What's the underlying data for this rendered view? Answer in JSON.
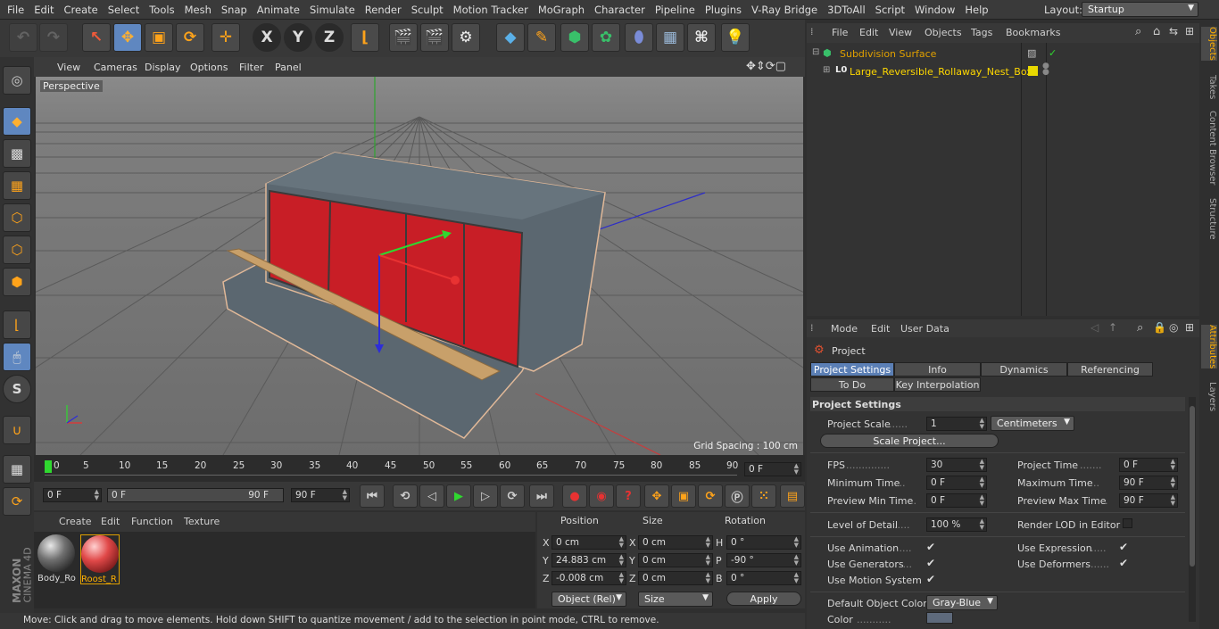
{
  "menubar": {
    "items": [
      "File",
      "Edit",
      "Create",
      "Select",
      "Tools",
      "Mesh",
      "Snap",
      "Animate",
      "Simulate",
      "Render",
      "Sculpt",
      "Motion Tracker",
      "MoGraph",
      "Character",
      "Pipeline",
      "Plugins",
      "V-Ray Bridge",
      "3DToAll",
      "Script",
      "Window",
      "Help"
    ],
    "layout_label": "Layout:",
    "layout_value": "Startup"
  },
  "toolbar": {
    "axis_x": "X",
    "axis_y": "Y",
    "axis_z": "Z"
  },
  "left_tools": {
    "snap_label": "S"
  },
  "viewport": {
    "menu": [
      "View",
      "Cameras",
      "Display",
      "Options",
      "Filter",
      "Panel"
    ],
    "label": "Perspective",
    "grid_spacing": "Grid Spacing : 100 cm"
  },
  "timeline": {
    "ticks": [
      "0",
      "5",
      "10",
      "15",
      "20",
      "25",
      "30",
      "35",
      "40",
      "45",
      "50",
      "55",
      "60",
      "65",
      "70",
      "75",
      "80",
      "85",
      "90"
    ],
    "current_frame": "0 F"
  },
  "transport": {
    "start": "0 F",
    "range_start": "0 F",
    "range_end": "90 F",
    "end": "90 F"
  },
  "materials": {
    "menu": [
      "Create",
      "Edit",
      "Function",
      "Texture"
    ],
    "items": [
      {
        "name": "Body_Ro"
      },
      {
        "name": "Roost_R"
      }
    ]
  },
  "coords": {
    "headers": [
      "Position",
      "Size",
      "Rotation"
    ],
    "rows": [
      {
        "axis": "X",
        "pos": "0 cm",
        "saxis": "X",
        "size": "0 cm",
        "raxis": "H",
        "rot": "0 °"
      },
      {
        "axis": "Y",
        "pos": "24.883 cm",
        "saxis": "Y",
        "size": "0 cm",
        "raxis": "P",
        "rot": "-90 °"
      },
      {
        "axis": "Z",
        "pos": "-0.008 cm",
        "saxis": "Z",
        "size": "0 cm",
        "raxis": "B",
        "rot": "0 °"
      }
    ],
    "mode": "Object (Rel)",
    "size_mode": "Size",
    "apply": "Apply"
  },
  "status": "Move: Click and drag to move elements. Hold down SHIFT to quantize movement / add to the selection in point mode, CTRL to remove.",
  "objects": {
    "menu": [
      "File",
      "Edit",
      "View",
      "Objects",
      "Tags",
      "Bookmarks"
    ],
    "tree": [
      {
        "name": "Subdivision Surface"
      },
      {
        "name": "Large_Reversible_Rollaway_Nest_Box"
      }
    ]
  },
  "attributes": {
    "menu": [
      "Mode",
      "Edit",
      "User Data"
    ],
    "title": "Project",
    "tabs": [
      "Project Settings",
      "Info",
      "Dynamics",
      "Referencing",
      "To Do",
      "Key Interpolation"
    ],
    "section": "Project Settings",
    "project_scale_label": "Project Scale",
    "project_scale_value": "1",
    "project_scale_unit": "Centimeters",
    "scale_button": "Scale Project...",
    "fps_label": "FPS",
    "fps_value": "30",
    "project_time_label": "Project Time",
    "project_time_value": "0 F",
    "min_time_label": "Minimum Time",
    "min_time_value": "0 F",
    "max_time_label": "Maximum Time",
    "max_time_value": "90 F",
    "prev_min_label": "Preview Min Time",
    "prev_min_value": "0 F",
    "prev_max_label": "Preview Max Time",
    "prev_max_value": "90 F",
    "lod_label": "Level of Detail",
    "lod_value": "100 %",
    "render_lod_label": "Render LOD in Editor",
    "use_anim_label": "Use Animation",
    "use_expr_label": "Use Expression",
    "use_gen_label": "Use Generators",
    "use_def_label": "Use Deformers",
    "use_motion_label": "Use Motion System",
    "default_color_label": "Default Object Color",
    "default_color_value": "Gray-Blue",
    "color_label": "Color"
  },
  "side_tabs": [
    "Objects",
    "Takes",
    "Content Browser",
    "Structure",
    "Attributes",
    "Layers"
  ],
  "brand": {
    "line1": "MAXON",
    "line2": "CINEMA 4D"
  }
}
